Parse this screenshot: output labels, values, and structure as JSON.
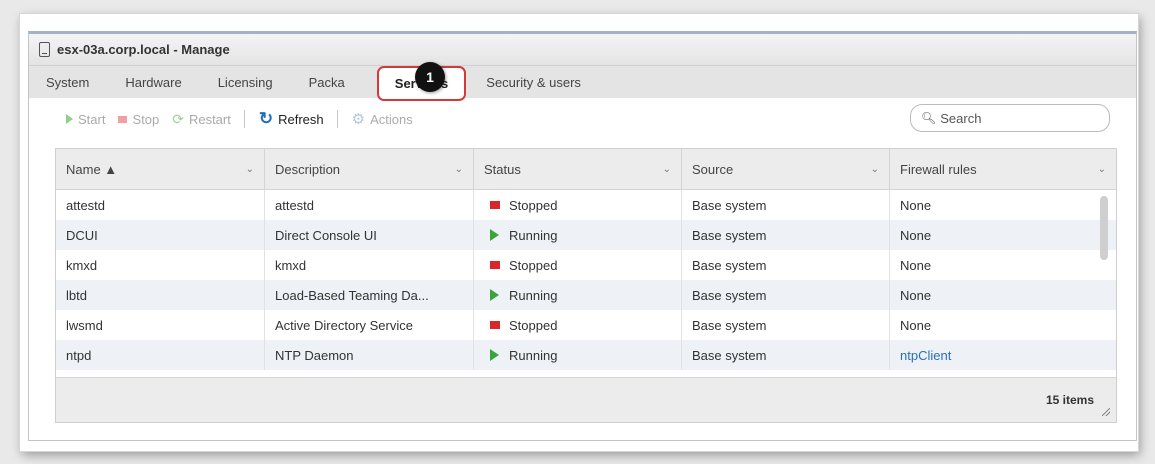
{
  "window": {
    "title": "esx-03a.corp.local - Manage"
  },
  "tabs": [
    {
      "label": "System"
    },
    {
      "label": "Hardware"
    },
    {
      "label": "Licensing"
    },
    {
      "label": "Packa"
    },
    {
      "label": "Services",
      "active": true
    },
    {
      "label": "Security & users"
    }
  ],
  "callout": {
    "number": "1"
  },
  "toolbar": {
    "start": "Start",
    "stop": "Stop",
    "restart": "Restart",
    "refresh": "Refresh",
    "actions": "Actions"
  },
  "search": {
    "placeholder": "Search"
  },
  "columns": [
    "Name ▲",
    "Description",
    "Status",
    "Source",
    "Firewall rules"
  ],
  "rows": [
    {
      "name": "attestd",
      "description": "attestd",
      "status": "Stopped",
      "source": "Base system",
      "firewall": "None"
    },
    {
      "name": "DCUI",
      "description": "Direct Console UI",
      "status": "Running",
      "source": "Base system",
      "firewall": "None"
    },
    {
      "name": "kmxd",
      "description": "kmxd",
      "status": "Stopped",
      "source": "Base system",
      "firewall": "None"
    },
    {
      "name": "lbtd",
      "description": "Load-Based Teaming Da...",
      "status": "Running",
      "source": "Base system",
      "firewall": "None"
    },
    {
      "name": "lwsmd",
      "description": "Active Directory Service",
      "status": "Stopped",
      "source": "Base system",
      "firewall": "None"
    },
    {
      "name": "ntpd",
      "description": "NTP Daemon",
      "status": "Running",
      "source": "Base system",
      "firewall": "ntpClient"
    }
  ],
  "footer": {
    "count": "15 items"
  },
  "colors": {
    "running": "#3aa63a",
    "stopped": "#d9262a",
    "highlight": "#d23a3a",
    "link": "#2a6ebb"
  }
}
